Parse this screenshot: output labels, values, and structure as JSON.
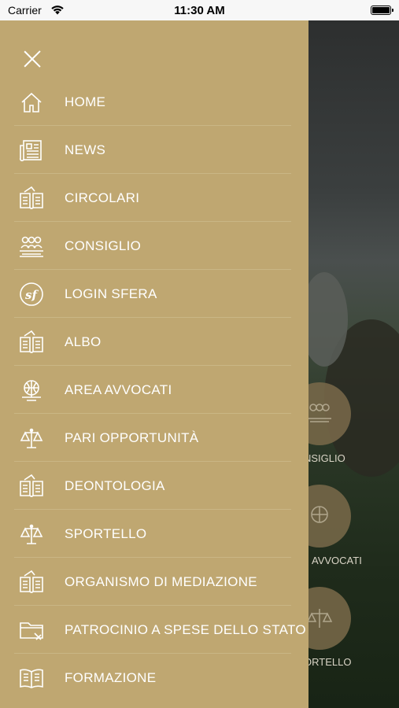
{
  "status_bar": {
    "carrier": "Carrier",
    "time": "11:30 AM"
  },
  "drawer": {
    "items": [
      {
        "label": "HOME",
        "icon": "home-icon"
      },
      {
        "label": "NEWS",
        "icon": "newspaper-icon"
      },
      {
        "label": "CIRCOLARI",
        "icon": "book-icon"
      },
      {
        "label": "CONSIGLIO",
        "icon": "people-icon"
      },
      {
        "label": "LOGIN SFERA",
        "icon": "sf-logo-icon"
      },
      {
        "label": "ALBO",
        "icon": "book-icon"
      },
      {
        "label": "AREA AVVOCATI",
        "icon": "globe-monitor-icon"
      },
      {
        "label": "PARI OPPORTUNITÀ",
        "icon": "scales-icon"
      },
      {
        "label": "DEONTOLOGIA",
        "icon": "book-icon"
      },
      {
        "label": "SPORTELLO",
        "icon": "scales-icon"
      },
      {
        "label": "ORGANISMO DI MEDIAZIONE",
        "icon": "book-icon"
      },
      {
        "label": "PATROCINIO A SPESE DELLO STATO",
        "icon": "folder-icon"
      },
      {
        "label": "FORMAZIONE",
        "icon": "open-book-icon"
      }
    ]
  },
  "background": {
    "labels": [
      "NSIGLIO",
      "AVVOCATI",
      "ORTELLO"
    ]
  },
  "colors": {
    "drawer": "#bfa771",
    "divider": "#c9b685",
    "text": "#ffffff"
  }
}
